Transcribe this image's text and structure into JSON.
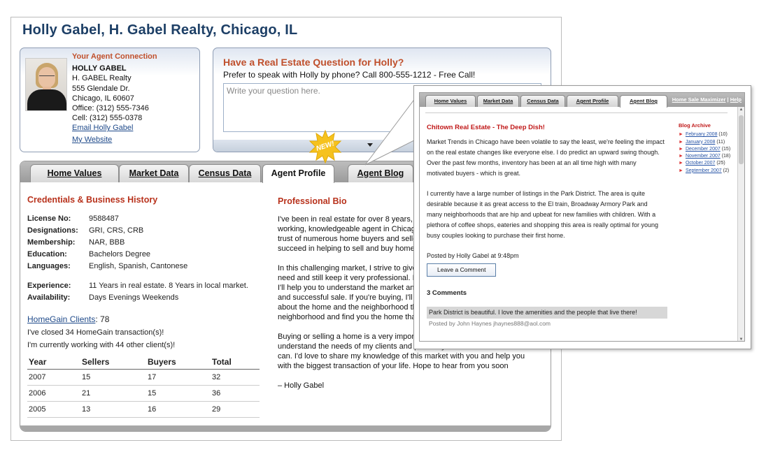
{
  "page_title": "Holly Gabel, H. Gabel Realty, Chicago, IL",
  "agent": {
    "section_title": "Your Agent Connection",
    "name": "HOLLY GABEL",
    "company": "H. GABEL Realty",
    "address1": "555 Glendale Dr.",
    "address2": "Chicago, IL 60607",
    "office": "Office: (312) 555-7346",
    "cell": "Cell: (312) 555-0378",
    "email_link": "Email Holly Gabel",
    "website_link": "My Website"
  },
  "question": {
    "title": "Have a Real Estate Question for Holly?",
    "subtitle": "Prefer to speak with Holly  by phone? Call 800-555-1212 - Free Call!",
    "placeholder": "Write your question here."
  },
  "tabs": [
    "Home Values",
    "Market Data",
    "Census Data",
    "Agent Profile",
    "Agent Blog"
  ],
  "active_tab": "Agent Profile",
  "new_badge": "NEW!",
  "credentials": {
    "title": "Credentials & Business History",
    "rows": [
      {
        "label": "License No:",
        "value": "9588487"
      },
      {
        "label": "Designations:",
        "value": "GRI, CRS, CRB"
      },
      {
        "label": "Membership:",
        "value": "NAR, BBB"
      },
      {
        "label": "Education:",
        "value": "Bachelors Degree"
      },
      {
        "label": "Languages:",
        "value": "English, Spanish, Cantonese"
      }
    ],
    "rows2": [
      {
        "label": "Experience:",
        "value": "11 Years in real estate. 8 Years in local market."
      },
      {
        "label": "Availability:",
        "value": "Days Evenings Weekends"
      }
    ]
  },
  "homegain": {
    "link": "HomeGain Clients",
    "count": ": 78",
    "line1": "I've closed 34 HomeGain transaction(s)!",
    "line2": "I'm currently working with 44 other client(s)!"
  },
  "stats": {
    "headers": [
      "Year",
      "Sellers",
      "Buyers",
      "Total"
    ],
    "rows": [
      [
        "2007",
        "15",
        "17",
        "32"
      ],
      [
        "2006",
        "21",
        "15",
        "36"
      ],
      [
        "2005",
        "13",
        "16",
        "29"
      ]
    ]
  },
  "bio": {
    "title": "Professional Bio",
    "p1": "I've been in real estate for over 8 years, and I pride myself on being a hard-working, knowledgeable agent in Chicago. Over the years I have earned the trust of numerous home buyers and sellers, and I have tried my hardest to succeed in helping to sell and buy homes for every one of my clients.",
    "p2": "In this challenging market, I strive to give my clients all the support they need and still keep it very professional. If you are buying or preparing to sell, I'll help you to understand the market and to make sure you have a quick and successful sale. If you're buying, I'll try to understand all the attributes about the home and the neighborhood that is most important to you in a neighborhood and find you the home that I would want for myself.",
    "p3": "Buying or selling a home is a very important step in your life and I want to understand the needs of my clients and provide you with the best service I can.  I'd love to share my knowledge of this market with you and help you with the biggest transaction of your life. Hope to hear from you soon",
    "sign": "– Holly Gabel"
  },
  "popup": {
    "tabs": [
      "Home Values",
      "Market Data",
      "Census Data",
      "Agent Profile",
      "Agent Blog"
    ],
    "right_link1": "Home Sale Maximizer",
    "separator": " | ",
    "right_link2": "Help",
    "blog_title": "Chitown Real Estate - The Deep Dish!",
    "para1": "Market Trends in Chicago have been volatile to say the least, we're feeling the impact on the real estate changes like everyone else. I do predict an upward swing though. Over the past few months, inventory has been at an all time high with many motivated buyers - which is great.",
    "para2": "I currently have a large number of listings in the Park District. The area is quite desirable because it as great access to the El train, Broadway Armory Park and many neighborhoods that are hip and upbeat for new families with children. With a plethora of coffee shops, eateries and shopping this area is really optimal for young busy couples looking to purchase their first home.",
    "posted": "Posted by Holly Gabel at 9:48pm",
    "comment_button": "Leave a Comment",
    "comments_heading": "3 Comments",
    "comment_text": "Park District is beautiful. I love the amenities and the people that live there!",
    "comment_by": "Posted by John Haynes jhaynes888@aol.com",
    "archive_title": "Blog Archive",
    "archive": [
      {
        "month": "February 2008",
        "count": "(10)"
      },
      {
        "month": "January 2008",
        "count": "(11)"
      },
      {
        "month": "December 2007",
        "count": "(15)"
      },
      {
        "month": "November 2007",
        "count": "(18)"
      },
      {
        "month": "October 2007",
        "count": "(25)"
      },
      {
        "month": "September 2007",
        "count": "(2)"
      }
    ]
  },
  "colors": {
    "title": "#1d3f66",
    "accent_red": "#b8321c",
    "link": "#1f4a8a",
    "badge": "#f6c21e"
  }
}
